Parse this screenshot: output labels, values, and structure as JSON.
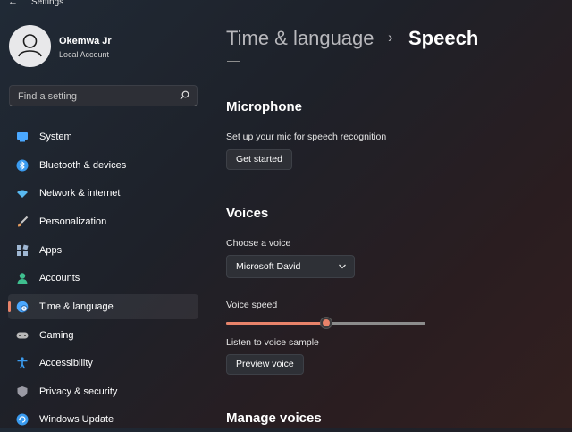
{
  "window": {
    "back_glyph": "←",
    "title": "Settings"
  },
  "user": {
    "name": "Okemwa Jr",
    "account_type": "Local Account"
  },
  "search": {
    "placeholder": "Find a setting",
    "value": ""
  },
  "nav": {
    "items": [
      {
        "label": "System",
        "icon": "system-icon",
        "color": "#4aa8ff"
      },
      {
        "label": "Bluetooth & devices",
        "icon": "bluetooth-icon",
        "color": "#3a9bef"
      },
      {
        "label": "Network & internet",
        "icon": "wifi-icon",
        "color": "#59b9f0"
      },
      {
        "label": "Personalization",
        "icon": "brush-icon",
        "color": "#e39c5f"
      },
      {
        "label": "Apps",
        "icon": "apps-icon",
        "color": "#9fb7d3"
      },
      {
        "label": "Accounts",
        "icon": "accounts-icon",
        "color": "#3fbf8f"
      },
      {
        "label": "Time & language",
        "icon": "globe-clock-icon",
        "color": "#4aa8ff",
        "active": true
      },
      {
        "label": "Gaming",
        "icon": "gamepad-icon",
        "color": "#b9b9b9"
      },
      {
        "label": "Accessibility",
        "icon": "accessibility-icon",
        "color": "#3a9bef"
      },
      {
        "label": "Privacy & security",
        "icon": "shield-icon",
        "color": "#9a9aa4"
      },
      {
        "label": "Windows Update",
        "icon": "update-icon",
        "color": "#3a9bef"
      }
    ]
  },
  "breadcrumb": {
    "parent": "Time & language",
    "separator": "›",
    "current": "Speech"
  },
  "microphone": {
    "heading": "Microphone",
    "description": "Set up your mic for speech recognition",
    "button": "Get started"
  },
  "voices": {
    "heading": "Voices",
    "choose_label": "Choose a voice",
    "selected_voice": "Microsoft David",
    "speed_label": "Voice speed",
    "speed_value": 0.5,
    "listen_label": "Listen to voice sample",
    "preview_button": "Preview voice"
  },
  "manage": {
    "heading": "Manage voices"
  },
  "colors": {
    "accent": "#e8836a"
  }
}
